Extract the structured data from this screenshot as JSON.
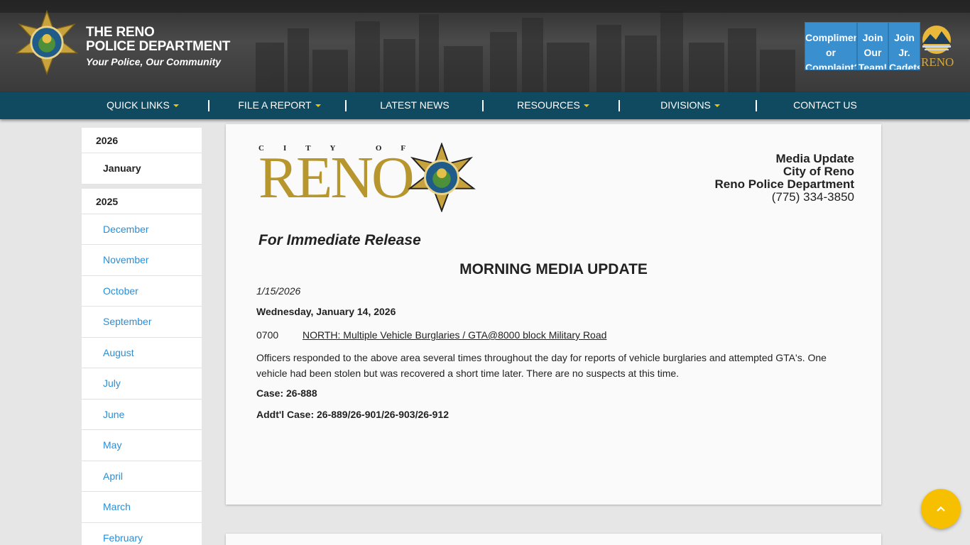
{
  "header": {
    "dept_line1": "THE RENO",
    "dept_line2": "POLICE DEPARTMENT",
    "tagline": "Your Police, Our Community",
    "buttons": [
      {
        "line1": "Complimen",
        "line2": "or",
        "line3": "Complaint?"
      },
      {
        "line1": "Join",
        "line2": "Our",
        "line3": "Team!"
      },
      {
        "line1": "Join",
        "line2": "Jr.",
        "line3": "Cadets"
      }
    ],
    "city_logo_text": "RENO"
  },
  "nav": {
    "items": [
      {
        "label": "QUICK LINKS",
        "dropdown": true
      },
      {
        "label": "FILE A REPORT",
        "dropdown": true
      },
      {
        "label": "LATEST NEWS",
        "dropdown": false
      },
      {
        "label": "RESOURCES",
        "dropdown": true
      },
      {
        "label": "DIVISIONS",
        "dropdown": true
      },
      {
        "label": "CONTACT US",
        "dropdown": false
      }
    ]
  },
  "sidebar": {
    "year2026": "2026",
    "months2026": [
      "January"
    ],
    "year2025": "2025",
    "months2025": [
      "December",
      "November",
      "October",
      "September",
      "August",
      "July",
      "June",
      "May",
      "April",
      "March",
      "February"
    ]
  },
  "release": {
    "city_of": "CITY OF",
    "reno": "RENO",
    "contact_title": "Media Update",
    "contact_city": "City of Reno",
    "contact_dept": "Reno Police Department",
    "contact_phone": "(775) 334-3850",
    "for_release": "For Immediate Release",
    "headline": "MORNING MEDIA UPDATE",
    "date": "1/15/2026",
    "day": "Wednesday, January 14, 2026",
    "time": "0700",
    "incident": "NORTH: Multiple Vehicle Burglaries / GTA@8000 block Military Road",
    "body": "Officers responded to the above area several times throughout the day for reports of vehicle burglaries and attempted GTA's. One vehicle had been stolen but was recovered a short time later. There are no suspects at this time.",
    "case": "Case: 26-888",
    "addl_case": "Addt'l Case: 26-889/26-901/26-903/26-912"
  },
  "colors": {
    "nav_bg": "#0f4a61",
    "accent_yellow": "#f6c000",
    "link_blue": "#2a8ed6",
    "header_button": "#3a8fcf",
    "reno_gold": "#b8962e"
  }
}
